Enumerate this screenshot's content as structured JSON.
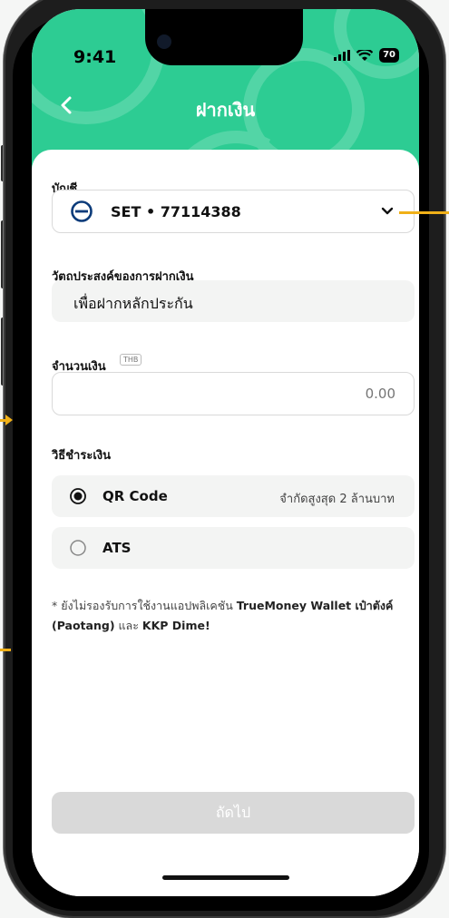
{
  "status_bar": {
    "time": "9:41",
    "battery": "70"
  },
  "header": {
    "title": "ฝากเงิน"
  },
  "account": {
    "label": "บัญชี",
    "value": "SET • 77114388"
  },
  "purpose": {
    "label": "วัตถุประสงค์ของการฝากเงิน",
    "value": "เพื่อฝากหลักประกัน"
  },
  "amount": {
    "label": "จำนวนเงิน",
    "currency": "THB",
    "placeholder": "0.00"
  },
  "payment": {
    "label": "วิธีชำระเงิน",
    "options": [
      {
        "name": "QR Code",
        "limit": "จำกัดสูงสุด 2 ล้านบาท",
        "selected": true
      },
      {
        "name": "ATS",
        "limit": "",
        "selected": false
      }
    ]
  },
  "note": {
    "prefix": "* ยังไม่รองรับการใช้งานแอปพลิเคชัน ",
    "app1": "TrueMoney Wallet เป๋าตังค์ (Paotang)",
    "middle": " และ ",
    "app2": "KKP Dime!"
  },
  "footer": {
    "next_label": "ถัดไป"
  },
  "colors": {
    "brand_green": "#2dcc93",
    "accent_callout": "#f0b018"
  }
}
